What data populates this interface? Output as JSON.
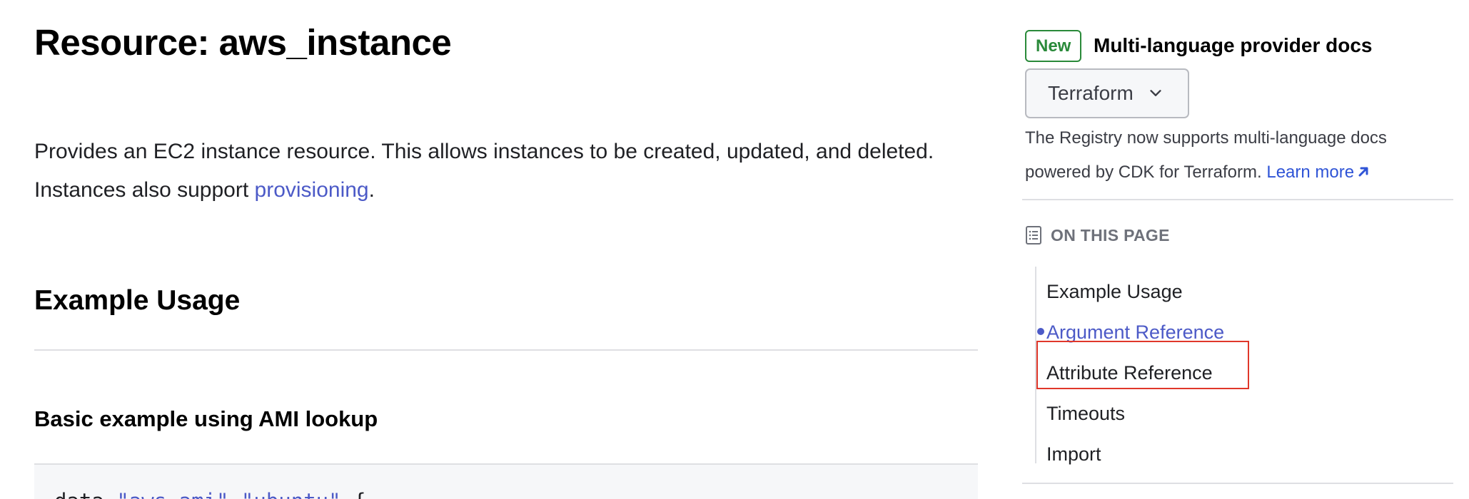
{
  "main": {
    "title": "Resource: aws_instance",
    "intro_text": "Provides an EC2 instance resource. This allows instances to be created, updated, and deleted. Instances also support ",
    "intro_link": "provisioning",
    "intro_end": ".",
    "section_title": "Example Usage",
    "subsection_title": "Basic example using AMI lookup",
    "code": {
      "keyword": "data ",
      "arg1": "\"aws_ami\"",
      "arg2": "\"ubuntu\"",
      "brace": " {"
    }
  },
  "sidebar": {
    "badge": "New",
    "heading": "Multi-language provider docs",
    "language_selected": "Terraform",
    "description": "The Registry now supports multi-language docs powered by CDK for Terraform.",
    "learn_more": "Learn more",
    "on_this_page": "ON THIS PAGE",
    "toc": [
      {
        "label": "Example Usage",
        "active": false
      },
      {
        "label": "Argument Reference",
        "active": true
      },
      {
        "label": "Attribute Reference",
        "active": false
      },
      {
        "label": "Timeouts",
        "active": false
      },
      {
        "label": "Import",
        "active": false
      }
    ]
  },
  "colors": {
    "link": "#4c5ac7",
    "badge_green": "#2a8a3a",
    "highlight_red": "#e0372a"
  }
}
